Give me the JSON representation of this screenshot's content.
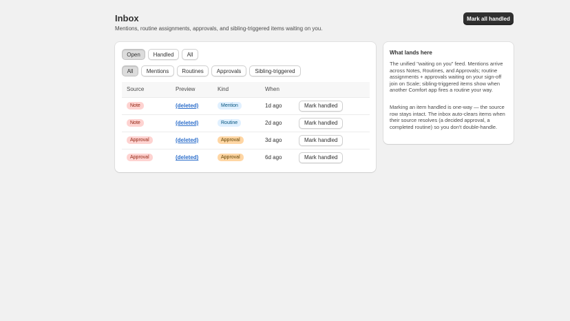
{
  "header": {
    "title": "Inbox",
    "subtitle": "Mentions, routine assignments, approvals, and sibling-triggered items waiting on you.",
    "mark_all_label": "Mark all handled"
  },
  "status_filters": [
    {
      "label": "Open",
      "active": true
    },
    {
      "label": "Handled",
      "active": false
    },
    {
      "label": "All",
      "active": false
    }
  ],
  "type_filters": [
    {
      "label": "All",
      "active": true
    },
    {
      "label": "Mentions",
      "active": false
    },
    {
      "label": "Routines",
      "active": false
    },
    {
      "label": "Approvals",
      "active": false
    },
    {
      "label": "Sibling-triggered",
      "active": false
    }
  ],
  "table": {
    "columns": [
      "Source",
      "Preview",
      "Kind",
      "When",
      ""
    ],
    "rows": [
      {
        "source": "Note",
        "preview": "(deleted)",
        "kind": "Mention",
        "when": "1d ago",
        "action": "Mark handled"
      },
      {
        "source": "Note",
        "preview": "(deleted)",
        "kind": "Routine",
        "when": "2d ago",
        "action": "Mark handled"
      },
      {
        "source": "Approval",
        "preview": "(deleted)",
        "kind": "Approval",
        "when": "3d ago",
        "action": "Mark handled"
      },
      {
        "source": "Approval",
        "preview": "(deleted)",
        "kind": "Approval",
        "when": "6d ago",
        "action": "Mark handled"
      }
    ]
  },
  "side_card": {
    "title": "What lands here",
    "paragraph1": "The unified \"waiting on you\" feed. Mentions arrive across Notes, Routines, and Approvals; routine assignments + approvals waiting on your sign-off join on Scale; sibling-triggered items show when another Comfort app fires a routine your way.",
    "paragraph2": "Marking an item handled is one-way — the source row stays intact. The inbox auto-clears items when their source resolves (a decided approval, a completed routine) so you don't double-handle."
  }
}
